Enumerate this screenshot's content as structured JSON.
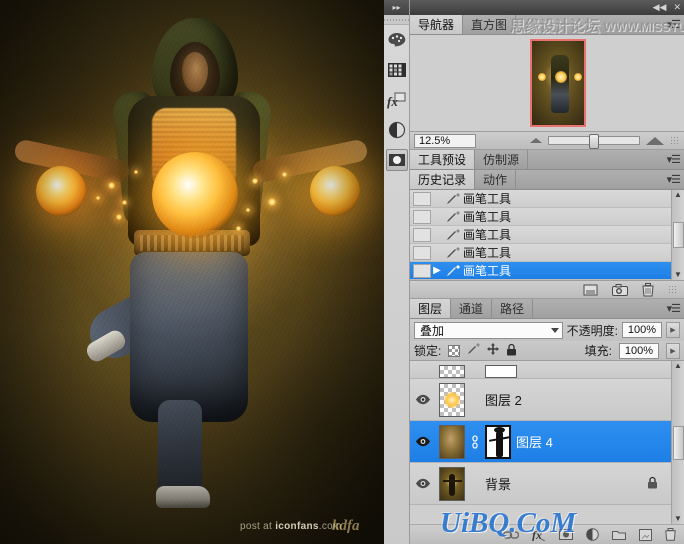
{
  "app": {
    "watermark_top": "思缘设计论坛",
    "watermark_url": "WWW.MISSYUAN.COM",
    "watermark_bottom": "UiBQ.CoM",
    "collapse_icon": "◀◀",
    "close_icon": "✕"
  },
  "canvas": {
    "credit_prefix": "post at ",
    "credit_brand": "iconfans",
    "credit_suffix": ".com",
    "credit_signature": "kdfa"
  },
  "navigator": {
    "tabs": [
      {
        "label": "导航器",
        "active": true
      },
      {
        "label": "直方图",
        "active": false
      }
    ],
    "menu_icon": "▾☰",
    "zoom_value": "12.5%",
    "zoom_out_icon": "small-triangle-icon",
    "zoom_in_icon": "large-triangle-icon"
  },
  "tool_presets": {
    "tabs": [
      {
        "label": "工具预设",
        "active": true
      },
      {
        "label": "仿制源",
        "active": false
      }
    ],
    "menu_icon": "▾☰"
  },
  "history": {
    "tabs": [
      {
        "label": "历史记录",
        "active": true
      },
      {
        "label": "动作",
        "active": false
      }
    ],
    "menu_icon": "▾☰",
    "items": [
      {
        "label": "画笔工具",
        "selected": false,
        "current": false
      },
      {
        "label": "画笔工具",
        "selected": false,
        "current": false
      },
      {
        "label": "画笔工具",
        "selected": false,
        "current": false
      },
      {
        "label": "画笔工具",
        "selected": false,
        "current": false
      },
      {
        "label": "画笔工具",
        "selected": true,
        "current": true
      }
    ],
    "footer_icons": [
      "new-document-icon",
      "snapshot-camera-icon",
      "trash-icon"
    ]
  },
  "layers": {
    "tabs": [
      {
        "label": "图层",
        "active": true
      },
      {
        "label": "通道",
        "active": false
      },
      {
        "label": "路径",
        "active": false
      }
    ],
    "menu_icon": "▾☰",
    "blend_mode": "叠加",
    "opacity_label": "不透明度:",
    "opacity_value": "100%",
    "lock_label": "锁定:",
    "fill_label": "填充:",
    "fill_value": "100%",
    "lock_icons": [
      "lock-transparency-icon",
      "lock-paint-icon",
      "lock-move-icon",
      "lock-all-icon"
    ],
    "rows": [
      {
        "name": "",
        "kind": "partial",
        "selected": false,
        "visible": false,
        "locked": false
      },
      {
        "name": "图层 2",
        "kind": "transparent",
        "selected": false,
        "visible": true,
        "locked": false
      },
      {
        "name": "图层 4",
        "kind": "masked",
        "selected": true,
        "visible": true,
        "locked": false
      },
      {
        "name": "背景",
        "kind": "photo",
        "selected": false,
        "visible": true,
        "locked": true
      }
    ],
    "footer_icons": [
      "link-layers-icon",
      "layer-style-fx-icon",
      "layer-mask-icon",
      "adjustment-layer-icon",
      "new-group-icon",
      "new-layer-icon",
      "delete-layer-icon"
    ]
  },
  "icon_rail": {
    "items": [
      {
        "name": "color-palette-icon"
      },
      {
        "name": "swatches-grid-icon"
      },
      {
        "name": "layer-style-fx-icon"
      },
      {
        "name": "adjustments-icon"
      },
      {
        "name": "masks-icon"
      }
    ]
  },
  "colors": {
    "selection_blue": "#1d7fe6",
    "panel_gray": "#cdcdcd",
    "titlebar_dark": "#3c3c3c",
    "navigator_frame": "#e8726e",
    "watermark_blue": "#1f6fd0"
  }
}
